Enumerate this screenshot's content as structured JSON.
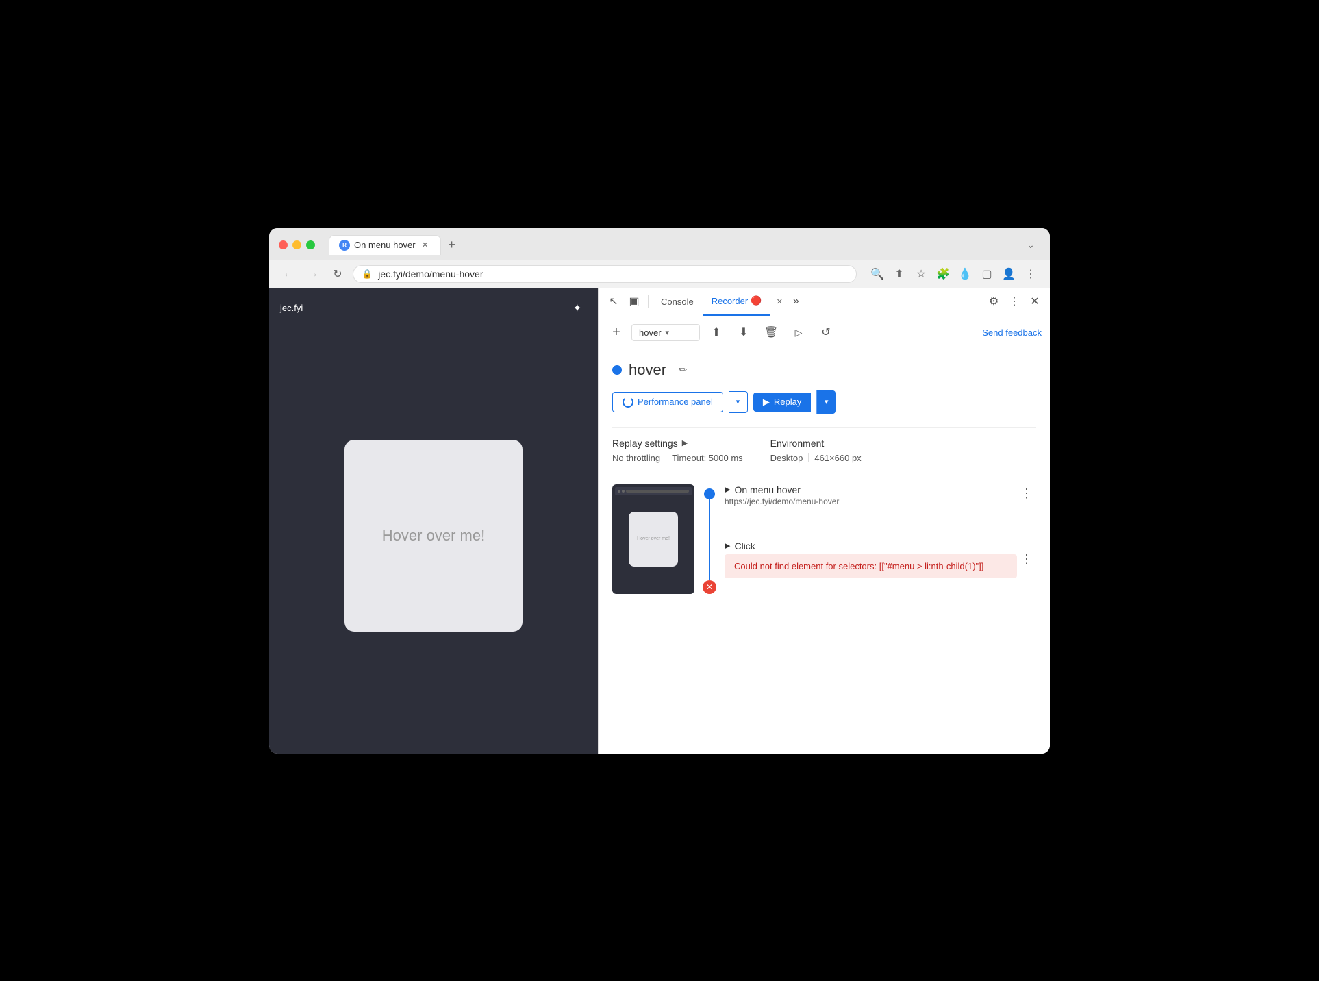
{
  "browser": {
    "tab_title": "On menu hover",
    "address": "jec.fyi/demo/menu-hover",
    "new_tab_label": "+",
    "chevron_label": "⌄"
  },
  "nav": {
    "back_label": "←",
    "forward_label": "→",
    "reload_label": "↻",
    "lock_icon": "🔒"
  },
  "address_actions": {
    "search_icon": "🔍",
    "share_icon": "⬆",
    "star_icon": "☆",
    "extension_icon": "🧩",
    "eyedropper_icon": "💧",
    "window_icon": "▢",
    "profile_icon": "👤",
    "more_icon": "⋮"
  },
  "page": {
    "site_name": "jec.fyi",
    "hover_card_text": "Hover over me!"
  },
  "devtools": {
    "tools": {
      "cursor_icon": "↖",
      "dock_icon": "▣"
    },
    "tabs": [
      {
        "label": "Console",
        "active": false
      },
      {
        "label": "Recorder",
        "active": true
      }
    ],
    "more_tabs_icon": "»",
    "settings_icon": "⚙",
    "dots_icon": "⋮",
    "close_icon": "✕"
  },
  "recorder_toolbar": {
    "add_label": "+",
    "dropdown_name": "hover",
    "upload_icon": "⬆",
    "download_icon": "⬇",
    "delete_icon": "🗑",
    "play_icon": "▷",
    "replay_icon": "↺",
    "send_feedback_label": "Send feedback"
  },
  "recorder": {
    "recording_dot_color": "#1a73e8",
    "recording_name": "hover",
    "edit_icon": "✏",
    "performance_panel_label": "Performance panel",
    "performance_panel_icon": "⟳",
    "perf_dropdown_icon": "▾",
    "replay_label": "Replay",
    "replay_play_icon": "▶",
    "replay_dropdown_icon": "▾"
  },
  "replay_settings": {
    "header": "Replay settings",
    "expand_icon": "▶",
    "throttling": "No throttling",
    "timeout_label": "Timeout: 5000 ms"
  },
  "environment": {
    "header": "Environment",
    "device": "Desktop",
    "resolution": "461×660 px"
  },
  "steps": [
    {
      "name": "On menu hover",
      "url": "https://jec.fyi/demo/menu-hover",
      "expand_icon": "▶",
      "more_icon": "⋮"
    }
  ],
  "click_step": {
    "name": "Click",
    "expand_icon": "▶",
    "more_icon": "⋮",
    "error_message": "Could not find element for selectors: [[\"#menu > li:nth-child(1)\"]]"
  }
}
